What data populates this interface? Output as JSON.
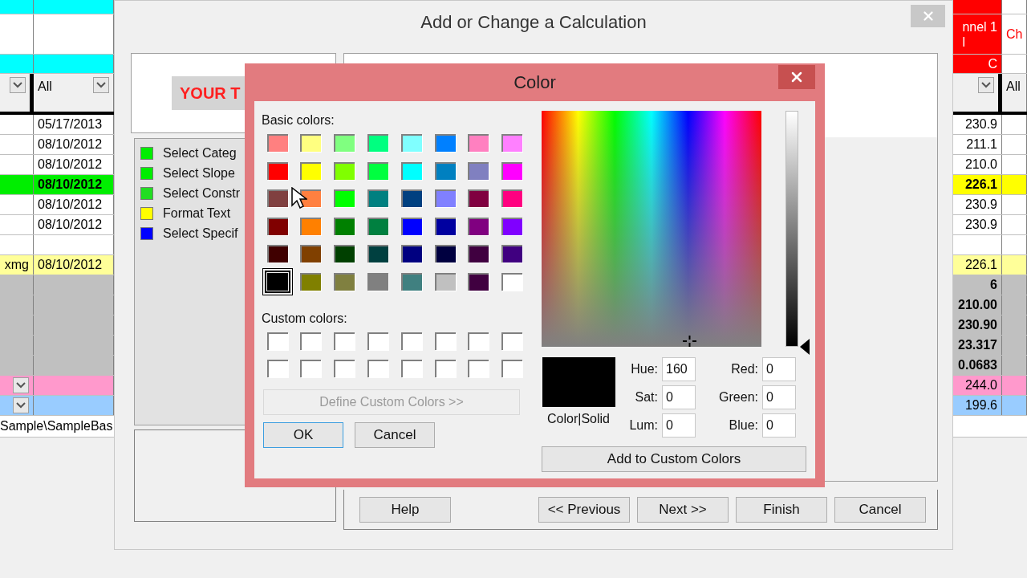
{
  "sheet_left": {
    "rows": [
      {
        "kind": "top",
        "cells": [
          {
            "color": "#00ffff"
          },
          {
            "color": "#00ffff"
          }
        ]
      },
      {
        "kind": "title",
        "cells": [
          {},
          {}
        ]
      },
      {
        "kind": "band",
        "cells": [
          {
            "color": "#00ffff"
          },
          {
            "color": "#00ffff"
          }
        ]
      },
      {
        "kind": "filter",
        "cells": [
          {
            "dropdown": true
          },
          {
            "text": "All",
            "dropdown": true
          }
        ]
      },
      {
        "kind": "data",
        "bold": false,
        "cells": [
          {},
          {
            "text": "05/17/2013"
          }
        ]
      },
      {
        "kind": "data",
        "bold": false,
        "cells": [
          {},
          {
            "text": "08/10/2012"
          }
        ]
      },
      {
        "kind": "data",
        "bold": false,
        "cells": [
          {},
          {
            "text": "08/10/2012"
          }
        ]
      },
      {
        "kind": "data",
        "bold": true,
        "cells": [
          {
            "color": "#00ee00"
          },
          {
            "text": "08/10/2012",
            "color": "#00ee00"
          }
        ]
      },
      {
        "kind": "data",
        "bold": false,
        "cells": [
          {},
          {
            "text": "08/10/2012"
          }
        ]
      },
      {
        "kind": "data",
        "bold": false,
        "cells": [
          {},
          {
            "text": "08/10/2012"
          }
        ]
      },
      {
        "kind": "data",
        "cells": [
          {},
          {}
        ]
      },
      {
        "kind": "data",
        "bold": false,
        "cells": [
          {
            "text": "xmg",
            "color": "#ffff99"
          },
          {
            "text": "08/10/2012",
            "color": "#ffff99"
          }
        ]
      },
      {
        "kind": "data",
        "cells": [
          {
            "color": "#c0c0c0"
          },
          {
            "color": "#c0c0c0"
          }
        ]
      },
      {
        "kind": "data",
        "cells": [
          {
            "color": "#c0c0c0"
          },
          {
            "color": "#c0c0c0"
          }
        ]
      },
      {
        "kind": "data",
        "cells": [
          {
            "color": "#c0c0c0"
          },
          {
            "color": "#c0c0c0"
          }
        ]
      },
      {
        "kind": "data",
        "cells": [
          {
            "color": "#c0c0c0"
          },
          {
            "color": "#c0c0c0"
          }
        ]
      },
      {
        "kind": "data",
        "cells": [
          {
            "color": "#c0c0c0"
          },
          {
            "color": "#c0c0c0"
          }
        ]
      },
      {
        "kind": "data",
        "cells": [
          {
            "color": "#ff99cc",
            "dropdown": true
          },
          {
            "color": "#ff99cc"
          }
        ]
      },
      {
        "kind": "data",
        "cells": [
          {
            "color": "#99ccff",
            "dropdown": true
          },
          {
            "color": "#99ccff"
          }
        ]
      },
      {
        "kind": "path",
        "cells": [
          {
            "text": "Sample\\SampleBas"
          }
        ]
      }
    ]
  },
  "sheet_right": {
    "rows": [
      {
        "kind": "top",
        "cells": [
          {
            "color": "#ff0000"
          },
          {}
        ]
      },
      {
        "kind": "title",
        "cells": [
          {
            "heading": {
              "lines": [
                "nnel 1",
                "l"
              ],
              "color": "#ffffff"
            },
            "color": "#ff0000"
          },
          {
            "heading": {
              "lines": [
                "Ch"
              ],
              "color": "#ff0000"
            }
          }
        ]
      },
      {
        "kind": "band",
        "cells": [
          {
            "heading": {
              "lines": [
                "C"
              ],
              "color": "#ffffff"
            },
            "color": "#ff0000"
          },
          {}
        ]
      },
      {
        "kind": "filter",
        "cells": [
          {
            "dropdown": true
          },
          {
            "text": "All"
          }
        ]
      },
      {
        "kind": "data",
        "bold": false,
        "cells": [
          {
            "text": "230.9"
          },
          {}
        ]
      },
      {
        "kind": "data",
        "bold": false,
        "cells": [
          {
            "text": "211.1"
          },
          {}
        ]
      },
      {
        "kind": "data",
        "bold": false,
        "cells": [
          {
            "text": "210.0"
          },
          {}
        ]
      },
      {
        "kind": "data",
        "bold": true,
        "cells": [
          {
            "text": "226.1",
            "color": "#ffff00"
          },
          {
            "color": "#ffff00"
          }
        ]
      },
      {
        "kind": "data",
        "bold": false,
        "cells": [
          {
            "text": "230.9"
          },
          {}
        ]
      },
      {
        "kind": "data",
        "bold": false,
        "cells": [
          {
            "text": "230.9"
          },
          {}
        ]
      },
      {
        "kind": "data",
        "cells": [
          {},
          {}
        ]
      },
      {
        "kind": "data",
        "bold": false,
        "cells": [
          {
            "text": "226.1",
            "color": "#ffff99"
          },
          {
            "color": "#ffff99"
          }
        ]
      },
      {
        "kind": "data",
        "bold": true,
        "cells": [
          {
            "text": "6",
            "color": "#c0c0c0"
          },
          {
            "color": "#c0c0c0"
          }
        ]
      },
      {
        "kind": "data",
        "bold": true,
        "cells": [
          {
            "text": "210.00",
            "color": "#c0c0c0"
          },
          {
            "color": "#c0c0c0"
          }
        ]
      },
      {
        "kind": "data",
        "bold": true,
        "cells": [
          {
            "text": "230.90",
            "color": "#c0c0c0"
          },
          {
            "color": "#c0c0c0"
          }
        ]
      },
      {
        "kind": "data",
        "bold": true,
        "cells": [
          {
            "text": "23.317",
            "color": "#c0c0c0"
          },
          {
            "color": "#c0c0c0"
          }
        ]
      },
      {
        "kind": "data",
        "bold": true,
        "cells": [
          {
            "text": "0.0683",
            "color": "#c0c0c0"
          },
          {
            "color": "#c0c0c0"
          }
        ]
      },
      {
        "kind": "data",
        "bold": false,
        "cells": [
          {
            "text": "244.0",
            "color": "#ff99cc"
          },
          {
            "color": "#ff99cc"
          }
        ]
      },
      {
        "kind": "data",
        "bold": false,
        "cells": [
          {
            "text": "199.6",
            "color": "#99ccff"
          },
          {
            "color": "#99ccff"
          }
        ]
      },
      {
        "kind": "path",
        "cells": []
      }
    ]
  },
  "dialog": {
    "title": "Add or Change a Calculation",
    "preview_text": "YOUR T",
    "steps": [
      {
        "label": "Select Categ",
        "color": "#00ee00"
      },
      {
        "label": "Select Slope",
        "color": "#00ee00"
      },
      {
        "label": "Select Constr",
        "color": "#22dd22"
      },
      {
        "label": "Format Text",
        "color": "#ffff00"
      },
      {
        "label": "Select Specif",
        "color": "#0000ff"
      }
    ],
    "buttons": [
      "Help",
      "<< Previous",
      "Next >>",
      "Finish",
      "Cancel"
    ]
  },
  "color_dialog": {
    "title": "Color",
    "basic_label": "Basic colors:",
    "basic_colors": [
      {
        "color": "#ff8080",
        "selected": false
      },
      {
        "color": "#ffff80",
        "selected": false
      },
      {
        "color": "#80ff80",
        "selected": false
      },
      {
        "color": "#00ff80",
        "selected": false
      },
      {
        "color": "#80ffff",
        "selected": false
      },
      {
        "color": "#0080ff",
        "selected": false
      },
      {
        "color": "#ff80c0",
        "selected": false
      },
      {
        "color": "#ff80ff",
        "selected": false
      },
      {
        "color": "#ff0000",
        "selected": false
      },
      {
        "color": "#ffff00",
        "selected": false
      },
      {
        "color": "#80ff00",
        "selected": false
      },
      {
        "color": "#00ff40",
        "selected": false
      },
      {
        "color": "#00ffff",
        "selected": false
      },
      {
        "color": "#0080c0",
        "selected": false
      },
      {
        "color": "#8080c0",
        "selected": false
      },
      {
        "color": "#ff00ff",
        "selected": false
      },
      {
        "color": "#804040",
        "selected": false
      },
      {
        "color": "#ff8040",
        "selected": false
      },
      {
        "color": "#00ff00",
        "selected": false
      },
      {
        "color": "#008080",
        "selected": false
      },
      {
        "color": "#004080",
        "selected": false
      },
      {
        "color": "#8080ff",
        "selected": false
      },
      {
        "color": "#800040",
        "selected": false
      },
      {
        "color": "#ff0080",
        "selected": false
      },
      {
        "color": "#800000",
        "selected": false
      },
      {
        "color": "#ff8000",
        "selected": false
      },
      {
        "color": "#008000",
        "selected": false
      },
      {
        "color": "#008040",
        "selected": false
      },
      {
        "color": "#0000ff",
        "selected": false
      },
      {
        "color": "#0000a0",
        "selected": false
      },
      {
        "color": "#800080",
        "selected": false
      },
      {
        "color": "#8000ff",
        "selected": false
      },
      {
        "color": "#400000",
        "selected": false
      },
      {
        "color": "#804000",
        "selected": false
      },
      {
        "color": "#004000",
        "selected": false
      },
      {
        "color": "#004040",
        "selected": false
      },
      {
        "color": "#000080",
        "selected": false
      },
      {
        "color": "#000040",
        "selected": false
      },
      {
        "color": "#400040",
        "selected": false
      },
      {
        "color": "#400080",
        "selected": false
      },
      {
        "color": "#000000",
        "selected": true
      },
      {
        "color": "#808000",
        "selected": false
      },
      {
        "color": "#808040",
        "selected": false
      },
      {
        "color": "#808080",
        "selected": false
      },
      {
        "color": "#408080",
        "selected": false
      },
      {
        "color": "#c0c0c0",
        "selected": false
      },
      {
        "color": "#400040",
        "selected": false
      },
      {
        "color": "#ffffff",
        "selected": false
      }
    ],
    "custom_label": "Custom colors:",
    "custom_colors": [
      {
        "color": "#ffffff"
      },
      {
        "color": "#ffffff"
      },
      {
        "color": "#ffffff"
      },
      {
        "color": "#ffffff"
      },
      {
        "color": "#ffffff"
      },
      {
        "color": "#ffffff"
      },
      {
        "color": "#ffffff"
      },
      {
        "color": "#ffffff"
      },
      {
        "color": "#ffffff"
      },
      {
        "color": "#ffffff"
      },
      {
        "color": "#ffffff"
      },
      {
        "color": "#ffffff"
      },
      {
        "color": "#ffffff"
      },
      {
        "color": "#ffffff"
      },
      {
        "color": "#ffffff"
      },
      {
        "color": "#ffffff"
      }
    ],
    "define_button": {
      "label": "Define Custom Colors >>",
      "disabled": true
    },
    "buttons": [
      {
        "label": "OK",
        "default": true
      },
      {
        "label": "Cancel",
        "default": false
      }
    ],
    "preview_swatch": {
      "color": "#000000"
    },
    "preview_label": "Color|Solid",
    "hsl_fields": [
      {
        "label": "Hue:",
        "value": "160"
      },
      {
        "label": "Sat:",
        "value": "0"
      },
      {
        "label": "Lum:",
        "value": "0"
      }
    ],
    "rgb_fields": [
      {
        "label": "Red:",
        "value": "0"
      },
      {
        "label": "Green:",
        "value": "0"
      },
      {
        "label": "Blue:",
        "value": "0"
      }
    ],
    "add_button": "Add to Custom Colors"
  }
}
